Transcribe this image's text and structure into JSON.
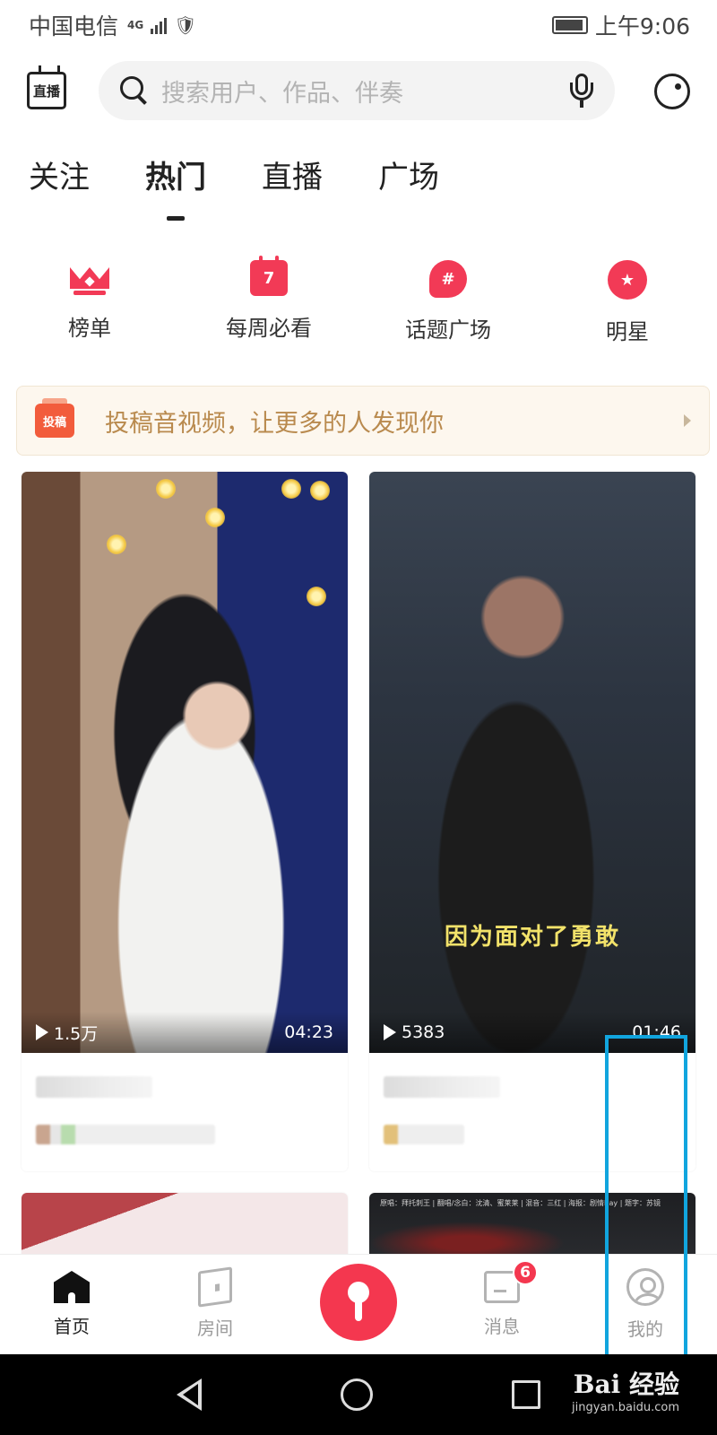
{
  "status_bar": {
    "carrier": "中国电信",
    "network": "4G",
    "time": "上午9:06"
  },
  "header": {
    "live_label": "直播",
    "search_placeholder": "搜索用户、作品、伴奏",
    "icons": [
      "live-icon",
      "search-icon",
      "mic-icon",
      "record-icon"
    ]
  },
  "tabs": [
    {
      "label": "关注",
      "active": false
    },
    {
      "label": "热门",
      "active": true
    },
    {
      "label": "直播",
      "active": false
    },
    {
      "label": "广场",
      "active": false
    }
  ],
  "quick_entries": [
    {
      "label": "榜单",
      "icon": "crown-icon"
    },
    {
      "label": "每周必看",
      "icon": "calendar-icon",
      "icon_text": "7"
    },
    {
      "label": "话题广场",
      "icon": "hashtag-icon",
      "icon_text": "#"
    },
    {
      "label": "明星",
      "icon": "star-icon",
      "icon_text": "★"
    }
  ],
  "banner": {
    "icon_text": "投稿",
    "text": "投稿音视频，让更多的人发现你"
  },
  "feed": [
    {
      "plays": "1.5万",
      "duration": "04:23",
      "caption": ""
    },
    {
      "plays": "5383",
      "duration": "01:46",
      "caption": "因为面对了勇敢"
    }
  ],
  "feed_partial": {
    "credits": "原唱：拜托刺王 | 翻唱/念白：沈清、蜜莱莱 | 混音：三红 | 海报：剧情Bay | 题字：苏镜"
  },
  "bottom_nav": [
    {
      "label": "首页",
      "icon": "home-icon",
      "active": true
    },
    {
      "label": "房间",
      "icon": "room-icon",
      "active": false
    },
    {
      "label": "",
      "icon": "sing-mic-icon",
      "active": false
    },
    {
      "label": "消息",
      "icon": "message-icon",
      "active": false,
      "badge": "6"
    },
    {
      "label": "我的",
      "icon": "profile-icon",
      "active": false
    }
  ],
  "watermark": {
    "brand": "Bai 经验",
    "url": "jingyan.baidu.com"
  },
  "colors": {
    "accent": "#f4374f",
    "banner_text": "#b98a4e",
    "highlight": "#11a5de"
  }
}
